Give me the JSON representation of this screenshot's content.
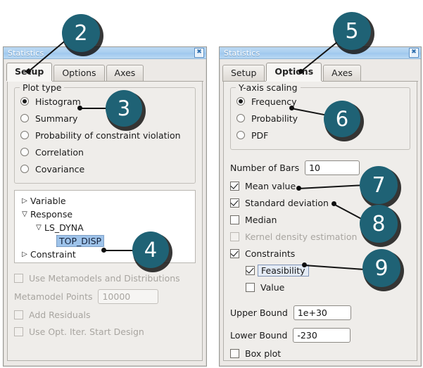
{
  "windows": {
    "left": {
      "title": "Statistics",
      "close_icon": "close-icon",
      "tabs": [
        {
          "label": "Setup",
          "active": true
        },
        {
          "label": "Options",
          "active": false
        },
        {
          "label": "Axes",
          "active": false
        }
      ],
      "plot_type": {
        "legend": "Plot type",
        "options": [
          {
            "label": "Histogram",
            "selected": true
          },
          {
            "label": "Summary",
            "selected": false
          },
          {
            "label": "Probability of constraint violation",
            "selected": false
          },
          {
            "label": "Correlation",
            "selected": false
          },
          {
            "label": "Covariance",
            "selected": false
          }
        ]
      },
      "tree": [
        {
          "label": "Variable",
          "arrow": "collapsed",
          "indent": 0,
          "selected": false
        },
        {
          "label": "Response",
          "arrow": "expanded",
          "indent": 0,
          "selected": false
        },
        {
          "label": "LS_DYNA",
          "arrow": "expanded",
          "indent": 1,
          "selected": false
        },
        {
          "label": "TOP_DISP",
          "arrow": "none",
          "indent": 2,
          "selected": true
        },
        {
          "label": "Constraint",
          "arrow": "collapsed",
          "indent": 0,
          "selected": false
        }
      ],
      "footer": {
        "use_metamodels": {
          "label": "Use Metamodels and Distributions",
          "checked": false,
          "enabled": false
        },
        "metamodel_points": {
          "label": "Metamodel Points",
          "value": "10000",
          "enabled": false
        },
        "add_residuals": {
          "label": "Add Residuals",
          "checked": false,
          "enabled": false
        },
        "use_opt_iter": {
          "label": "Use Opt. Iter. Start Design",
          "checked": false,
          "enabled": false
        }
      }
    },
    "right": {
      "title": "Statistics",
      "close_icon": "close-icon",
      "tabs": [
        {
          "label": "Setup",
          "active": false
        },
        {
          "label": "Options",
          "active": true
        },
        {
          "label": "Axes",
          "active": false
        }
      ],
      "y_axis_scaling": {
        "legend": "Y-axis scaling",
        "options": [
          {
            "label": "Frequency",
            "selected": true
          },
          {
            "label": "Probability",
            "selected": false
          },
          {
            "label": "PDF",
            "selected": false
          }
        ]
      },
      "number_of_bars": {
        "label": "Number of Bars",
        "value": "10"
      },
      "checks": [
        {
          "label": "Mean value",
          "checked": true,
          "enabled": true
        },
        {
          "label": "Standard deviation",
          "checked": true,
          "enabled": true
        },
        {
          "label": "Median",
          "checked": false,
          "enabled": true
        },
        {
          "label": "Kernel density estimation",
          "checked": false,
          "enabled": false
        },
        {
          "label": "Constraints",
          "checked": true,
          "enabled": true
        }
      ],
      "constraint_children": [
        {
          "label": "Feasibility",
          "checked": true,
          "focused": true
        },
        {
          "label": "Value",
          "checked": false,
          "focused": false
        }
      ],
      "upper_bound": {
        "label": "Upper Bound",
        "value": "1e+30"
      },
      "lower_bound": {
        "label": "Lower Bound",
        "value": "-230"
      },
      "box_plot": {
        "label": "Box plot",
        "checked": false
      }
    }
  },
  "callouts": [
    {
      "number": "2"
    },
    {
      "number": "3"
    },
    {
      "number": "4"
    },
    {
      "number": "5"
    },
    {
      "number": "6"
    },
    {
      "number": "7"
    },
    {
      "number": "8"
    },
    {
      "number": "9"
    }
  ],
  "colors": {
    "callout_fill": "#1f6275",
    "titlebar": "#a9cef0",
    "selection": "#9ec3ea"
  }
}
